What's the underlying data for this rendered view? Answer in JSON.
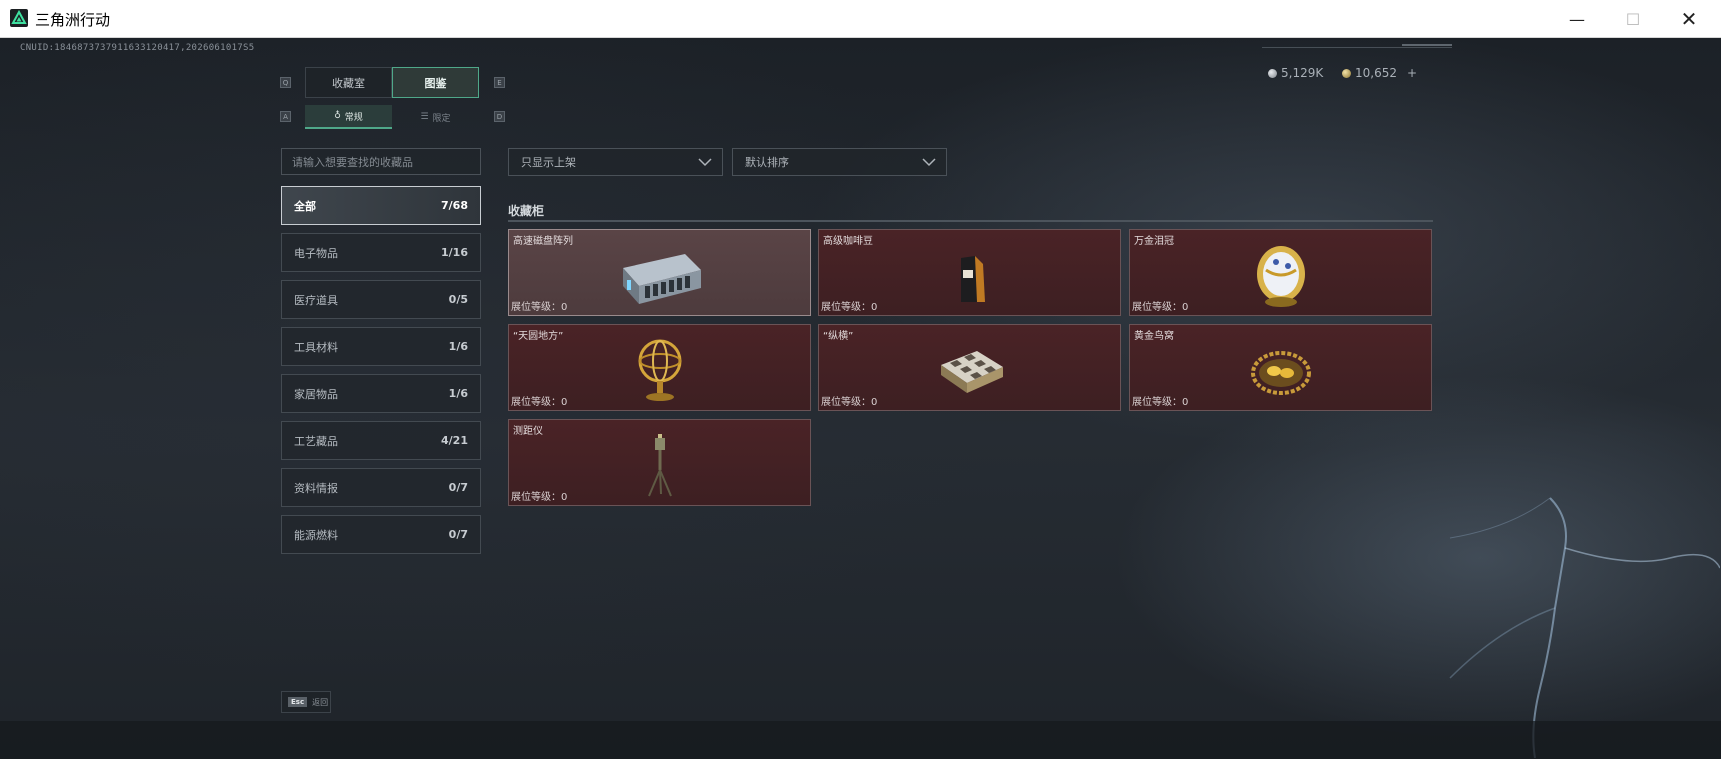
{
  "window": {
    "title": "三角洲行动",
    "minimize_glyph": "—",
    "maximize_glyph": "☐",
    "close_glyph": "✕"
  },
  "header": {
    "uid": "CNUID:1846873737911633120417,2026061017S5",
    "currency_silver": "5,129K",
    "currency_gold": "10,652",
    "currency_add": "+"
  },
  "hints": {
    "q": "Q",
    "e": "E",
    "a": "A",
    "d": "D"
  },
  "tabs": [
    {
      "label": "收藏室",
      "active": false
    },
    {
      "label": "图鉴",
      "active": true
    }
  ],
  "subtabs": [
    {
      "label": "常规",
      "icon": "gauge-icon",
      "active": true
    },
    {
      "label": "限定",
      "icon": "limited-icon",
      "active": false
    }
  ],
  "search": {
    "placeholder": "请输入想要查找的收藏品"
  },
  "filters": {
    "shelf_filter": "只显示上架",
    "sort": "默认排序"
  },
  "categories": [
    {
      "label": "全部",
      "count": "7/68",
      "active": true
    },
    {
      "label": "电子物品",
      "count": "1/16",
      "active": false
    },
    {
      "label": "医疗道具",
      "count": "0/5",
      "active": false
    },
    {
      "label": "工具材料",
      "count": "1/6",
      "active": false
    },
    {
      "label": "家居物品",
      "count": "1/6",
      "active": false
    },
    {
      "label": "工艺藏品",
      "count": "4/21",
      "active": false
    },
    {
      "label": "资料情报",
      "count": "0/7",
      "active": false
    },
    {
      "label": "能源燃料",
      "count": "0/7",
      "active": false
    }
  ],
  "cabinet": {
    "title": "收藏柜",
    "level_label": "展位等级：",
    "items": [
      {
        "name": "高速磁盘阵列",
        "level": "0",
        "art": "disk-array-icon",
        "selected": true
      },
      {
        "name": "高级咖啡豆",
        "level": "0",
        "art": "coffee-bag-icon",
        "selected": false
      },
      {
        "name": "万金泪冠",
        "level": "0",
        "art": "jeweled-egg-icon",
        "selected": false
      },
      {
        "name": "“天圆地方”",
        "level": "0",
        "art": "armillary-sphere-icon",
        "selected": false
      },
      {
        "name": "“纵横”",
        "level": "0",
        "art": "chessboard-icon",
        "selected": false
      },
      {
        "name": "黄金鸟窝",
        "level": "0",
        "art": "golden-nest-icon",
        "selected": false
      },
      {
        "name": "测距仪",
        "level": "0",
        "art": "rangefinder-icon",
        "selected": false
      }
    ]
  },
  "footer": {
    "esc_key": "Esc",
    "esc_label": "返回"
  },
  "colors": {
    "accent": "#4fa889",
    "card_bg": "#4a2326",
    "card_selected_bg": "#5a4446",
    "page_bg": "#1e2329"
  }
}
